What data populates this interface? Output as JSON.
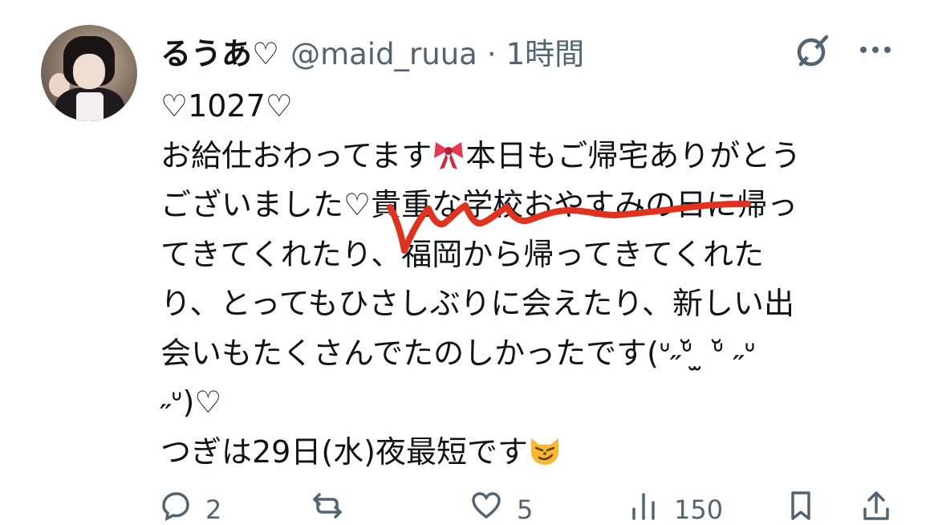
{
  "post": {
    "display_name": "るうあ♡",
    "handle": "@maid_ruua",
    "separator": "·",
    "time": "1時間",
    "text_lines": [
      "♡1027♡",
      "お給仕おわってます🎀本日もご帰宅ありがとう",
      "ございました♡貴重な学校おやすみの日に帰っ",
      "てきてくれたり、福岡から帰ってきてくれた",
      "り、とってもひさしぶりに会えたり、新しい出",
      "会いもたくさんでたのしかったです(ᐡ˶ᐡ̆ ̫ ᐡ̆ ˶ᐡ",
      "˶ᐡ)♡",
      "つぎは29日(水)夜最短です😼"
    ]
  },
  "actions": {
    "reply_count": "2",
    "repost_count": "",
    "like_count": "5",
    "views_count": "150"
  },
  "icons": {
    "ribbon": "ribbon-icon",
    "cat": "smirking-cat-icon",
    "grok": "grok-icon",
    "more": "more-icon"
  },
  "colors": {
    "text": "#0f1419",
    "secondary": "#536471",
    "scribble": "#e0321c"
  }
}
